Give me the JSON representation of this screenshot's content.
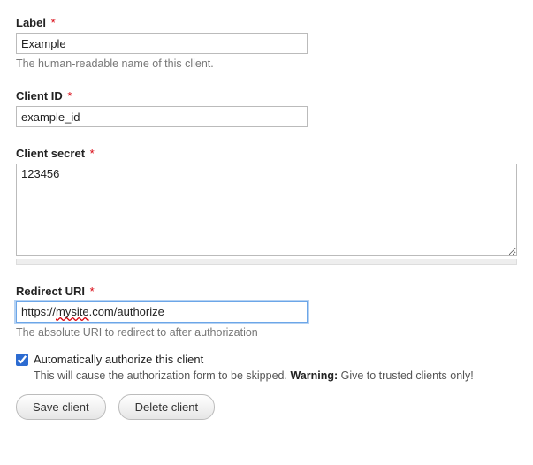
{
  "fields": {
    "label": {
      "label": "Label",
      "required_marker": "*",
      "value": "Example",
      "description": "The human-readable name of this client."
    },
    "client_id": {
      "label": "Client ID",
      "required_marker": "*",
      "value": "example_id"
    },
    "client_secret": {
      "label": "Client secret",
      "required_marker": "*",
      "value": "123456"
    },
    "redirect_uri": {
      "label": "Redirect URI",
      "required_marker": "*",
      "prefix": "https://",
      "misspelled": "mysite",
      "suffix": ".com/authorize",
      "description": "The absolute URI to redirect to after authorization"
    }
  },
  "checkbox": {
    "label": "Automatically authorize this client",
    "checked": true,
    "desc_before": "This will cause the authorization form to be skipped. ",
    "desc_warning_label": "Warning:",
    "desc_after": " Give to trusted clients only!"
  },
  "buttons": {
    "save": "Save client",
    "delete": "Delete client"
  }
}
